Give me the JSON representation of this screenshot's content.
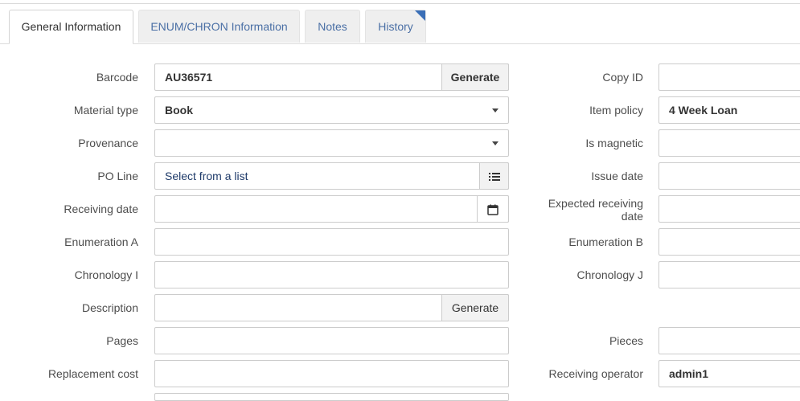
{
  "tabs": [
    {
      "label": "General Information"
    },
    {
      "label": "ENUM/CHRON Information"
    },
    {
      "label": "Notes"
    },
    {
      "label": "History"
    }
  ],
  "left": {
    "barcode": {
      "label": "Barcode",
      "value": "AU36571",
      "button": "Generate"
    },
    "material_type": {
      "label": "Material type",
      "value": "Book"
    },
    "provenance": {
      "label": "Provenance",
      "value": ""
    },
    "po_line": {
      "label": "PO Line",
      "value": "Select from a list"
    },
    "receiving_date": {
      "label": "Receiving date",
      "value": ""
    },
    "enumeration_a": {
      "label": "Enumeration A",
      "value": ""
    },
    "chronology_i": {
      "label": "Chronology I",
      "value": ""
    },
    "description": {
      "label": "Description",
      "value": "",
      "button": "Generate"
    },
    "pages": {
      "label": "Pages",
      "value": ""
    },
    "replacement_cost": {
      "label": "Replacement cost",
      "value": ""
    }
  },
  "right": {
    "copy_id": {
      "label": "Copy ID",
      "value": ""
    },
    "item_policy": {
      "label": "Item policy",
      "value": "4 Week Loan"
    },
    "is_magnetic": {
      "label": "Is magnetic",
      "value": ""
    },
    "issue_date": {
      "label": "Issue date",
      "value": ""
    },
    "expected_receiving_date": {
      "label_line1": "Expected receiving",
      "label_line2": "date",
      "value": ""
    },
    "enumeration_b": {
      "label": "Enumeration B",
      "value": ""
    },
    "chronology_j": {
      "label": "Chronology J",
      "value": ""
    },
    "pieces": {
      "label": "Pieces",
      "value": ""
    },
    "receiving_operator": {
      "label": "Receiving operator",
      "value": "admin1"
    }
  },
  "icons": {
    "list": "list-icon",
    "calendar": "calendar-icon",
    "dropdown": "chevron-down-icon"
  }
}
